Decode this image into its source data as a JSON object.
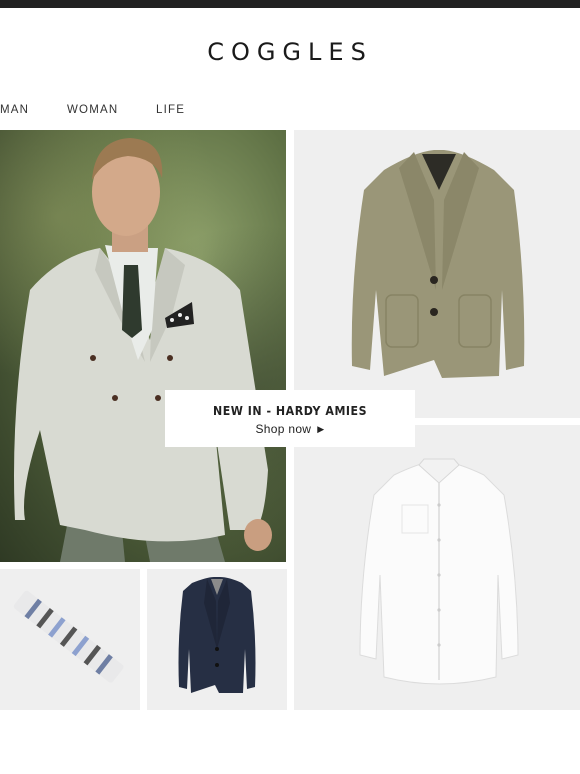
{
  "brand": {
    "name": "COGGLES"
  },
  "nav": {
    "items": [
      {
        "label": "MAN"
      },
      {
        "label": "WOMAN"
      },
      {
        "label": "LIFE"
      }
    ]
  },
  "promo": {
    "title": "NEW IN - HARDY AMIES",
    "cta": "Shop now",
    "cta_icon": "caret-right-icon"
  },
  "colors": {
    "top_bar": "#222222",
    "tile_bg": "#efefef",
    "text": "#222222"
  }
}
